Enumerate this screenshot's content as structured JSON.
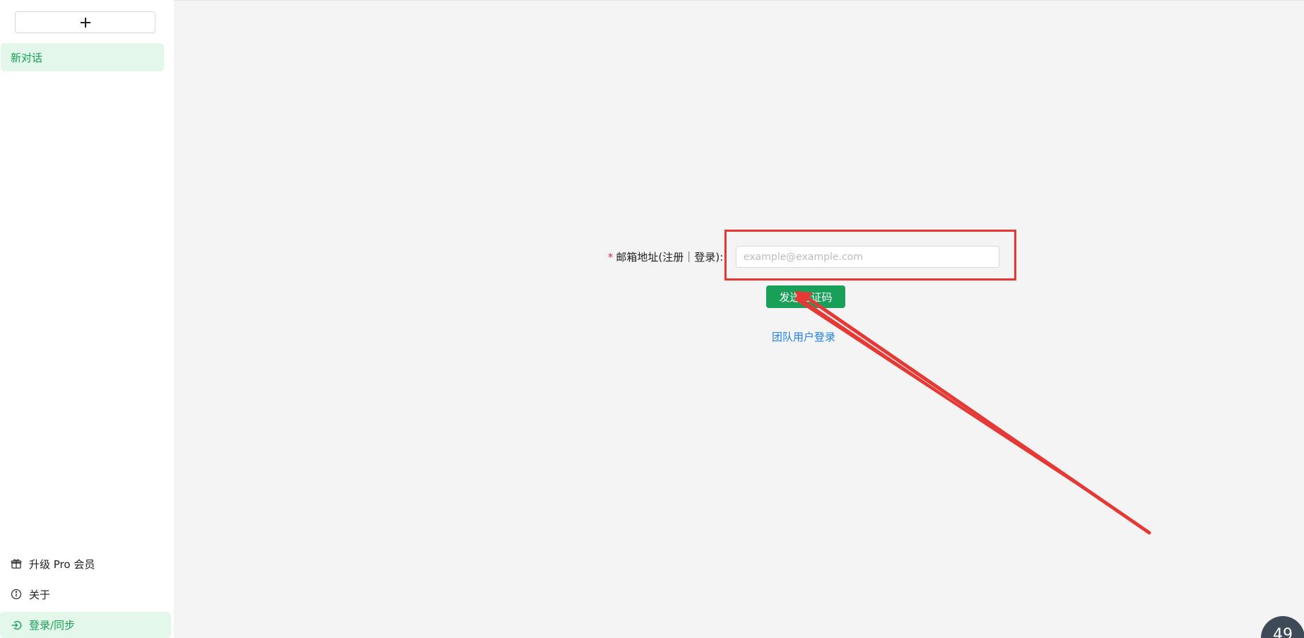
{
  "sidebar": {
    "new_chat_icon": "plus-icon",
    "conversations": [
      {
        "label": "新对话"
      }
    ],
    "bottom_items": {
      "upgrade": {
        "label": "升级 Pro 会员",
        "icon": "gift-icon"
      },
      "about": {
        "label": "关于",
        "icon": "info-icon"
      },
      "login": {
        "label": "登录/同步",
        "icon": "login-icon"
      }
    }
  },
  "form": {
    "required_mark": "*",
    "email_label": "邮箱地址(注册｜登录):",
    "email_placeholder": "example@example.com",
    "email_value": "",
    "send_code_label": "发送验证码",
    "team_login_label": "团队用户登录"
  },
  "widget": {
    "value": "49"
  },
  "colors": {
    "accent": "#18a058",
    "link": "#2080f0",
    "annotation": "#e53935"
  }
}
